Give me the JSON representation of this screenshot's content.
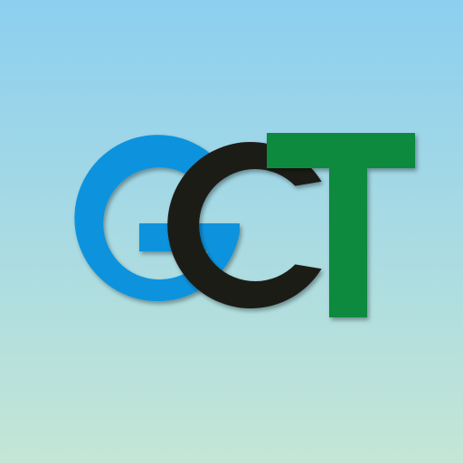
{
  "logo": {
    "text": "GCT",
    "letters": [
      {
        "char": "G",
        "color": "#0a93dd"
      },
      {
        "char": "C",
        "color": "#1d1a17"
      },
      {
        "char": "T",
        "color": "#0b8a3c"
      }
    ]
  },
  "background": {
    "top_color": "#8ccff0",
    "bottom_color": "#c4e6d6"
  }
}
